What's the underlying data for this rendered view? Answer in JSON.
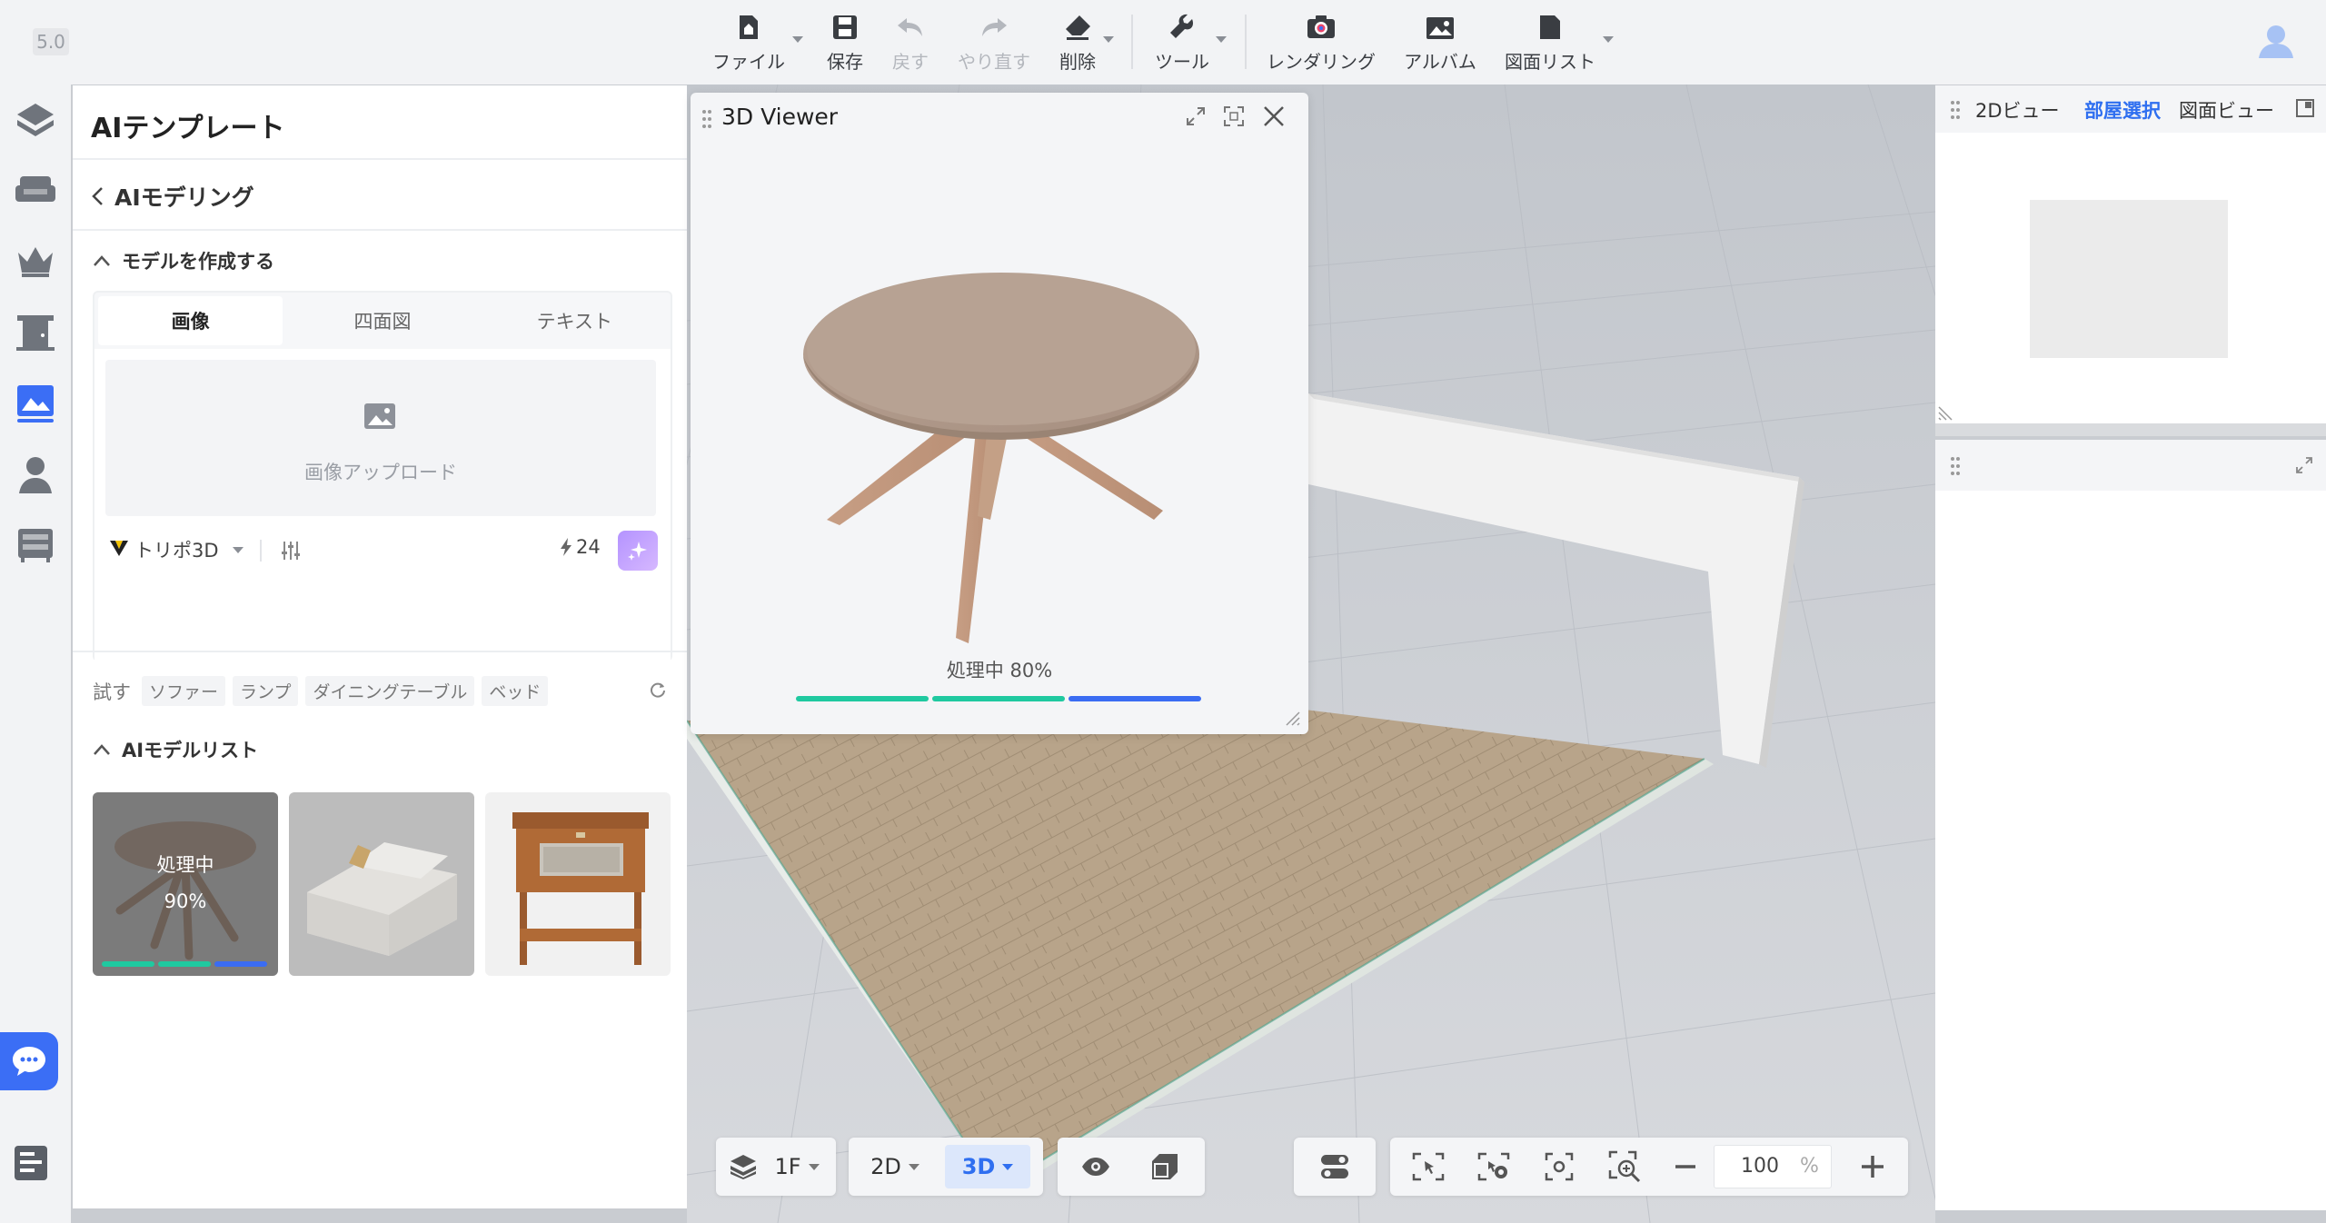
{
  "app": {
    "version": "5.0"
  },
  "toolbar": {
    "file": "ファイル",
    "save": "保存",
    "undo": "戻す",
    "redo": "やり直す",
    "delete": "削除",
    "tools": "ツール",
    "render": "レンダリング",
    "album": "アルバム",
    "drawing_list": "図面リスト"
  },
  "sidebar": {
    "items": [
      {
        "icon": "layers-icon"
      },
      {
        "icon": "sofa-icon"
      },
      {
        "icon": "crown-icon"
      },
      {
        "icon": "door-icon"
      },
      {
        "icon": "ai-template-icon",
        "active": true
      },
      {
        "icon": "person-icon"
      },
      {
        "icon": "cabinet-icon"
      }
    ]
  },
  "left_panel": {
    "title": "AIテンプレート",
    "back_label": "AIモデリング",
    "create_section_title": "モデルを作成する",
    "tabs": [
      "画像",
      "四面図",
      "テキスト"
    ],
    "active_tab": "画像",
    "upload_text": "画像アップロード",
    "model_name": "トリポ3D",
    "credits": "24",
    "try_label": "試す",
    "suggestions": [
      "ソファー",
      "ランプ",
      "ダイニングテーブル",
      "ベッド"
    ],
    "model_list_title": "AIモデルリスト",
    "model_list": [
      {
        "name": "round table",
        "status": "処理中",
        "progress": "90%"
      },
      {
        "name": "sofa"
      },
      {
        "name": "side table"
      }
    ]
  },
  "viewer": {
    "title": "3D Viewer",
    "status": "処理中 80%",
    "progress": 0.8
  },
  "right_panel": {
    "tabs": [
      "2Dビュー",
      "部屋選択",
      "図面ビュー"
    ],
    "active_tab": "部屋選択"
  },
  "bottom_toolbar": {
    "floor": "1F",
    "view_2d": "2D",
    "view_3d": "3D",
    "zoom_value": "100",
    "zoom_unit": "%"
  },
  "colors": {
    "accent": "#2f6ff0",
    "progress_green": "#1fc9a0",
    "progress_blue": "#3a6cf2",
    "chat": "#3b6ef5"
  }
}
